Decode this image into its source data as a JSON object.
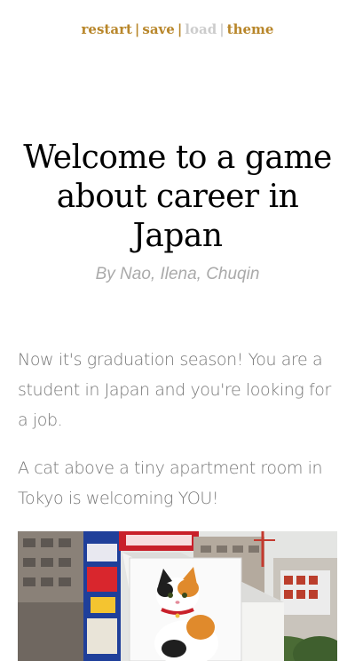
{
  "nav": {
    "restart": "restart",
    "save": "save",
    "load": "load",
    "theme": "theme",
    "separator": "|"
  },
  "title": "Welcome to a game about career in Japan",
  "byline": "By Nao, Ilena, Chuqin",
  "story": {
    "paragraph_1": "Now it's graduation season! You are a student in Japan and you're looking for a job.",
    "paragraph_2": "A cat above a tiny apartment room in Tokyo is welcoming YOU!"
  },
  "image": {
    "subject": "calico cat billboard on building in Tokyo"
  },
  "colors": {
    "link": "#b8862a",
    "link_disabled": "#cccccc",
    "byline": "#aaaaaa",
    "body_text": "#777777",
    "title": "#000000"
  }
}
